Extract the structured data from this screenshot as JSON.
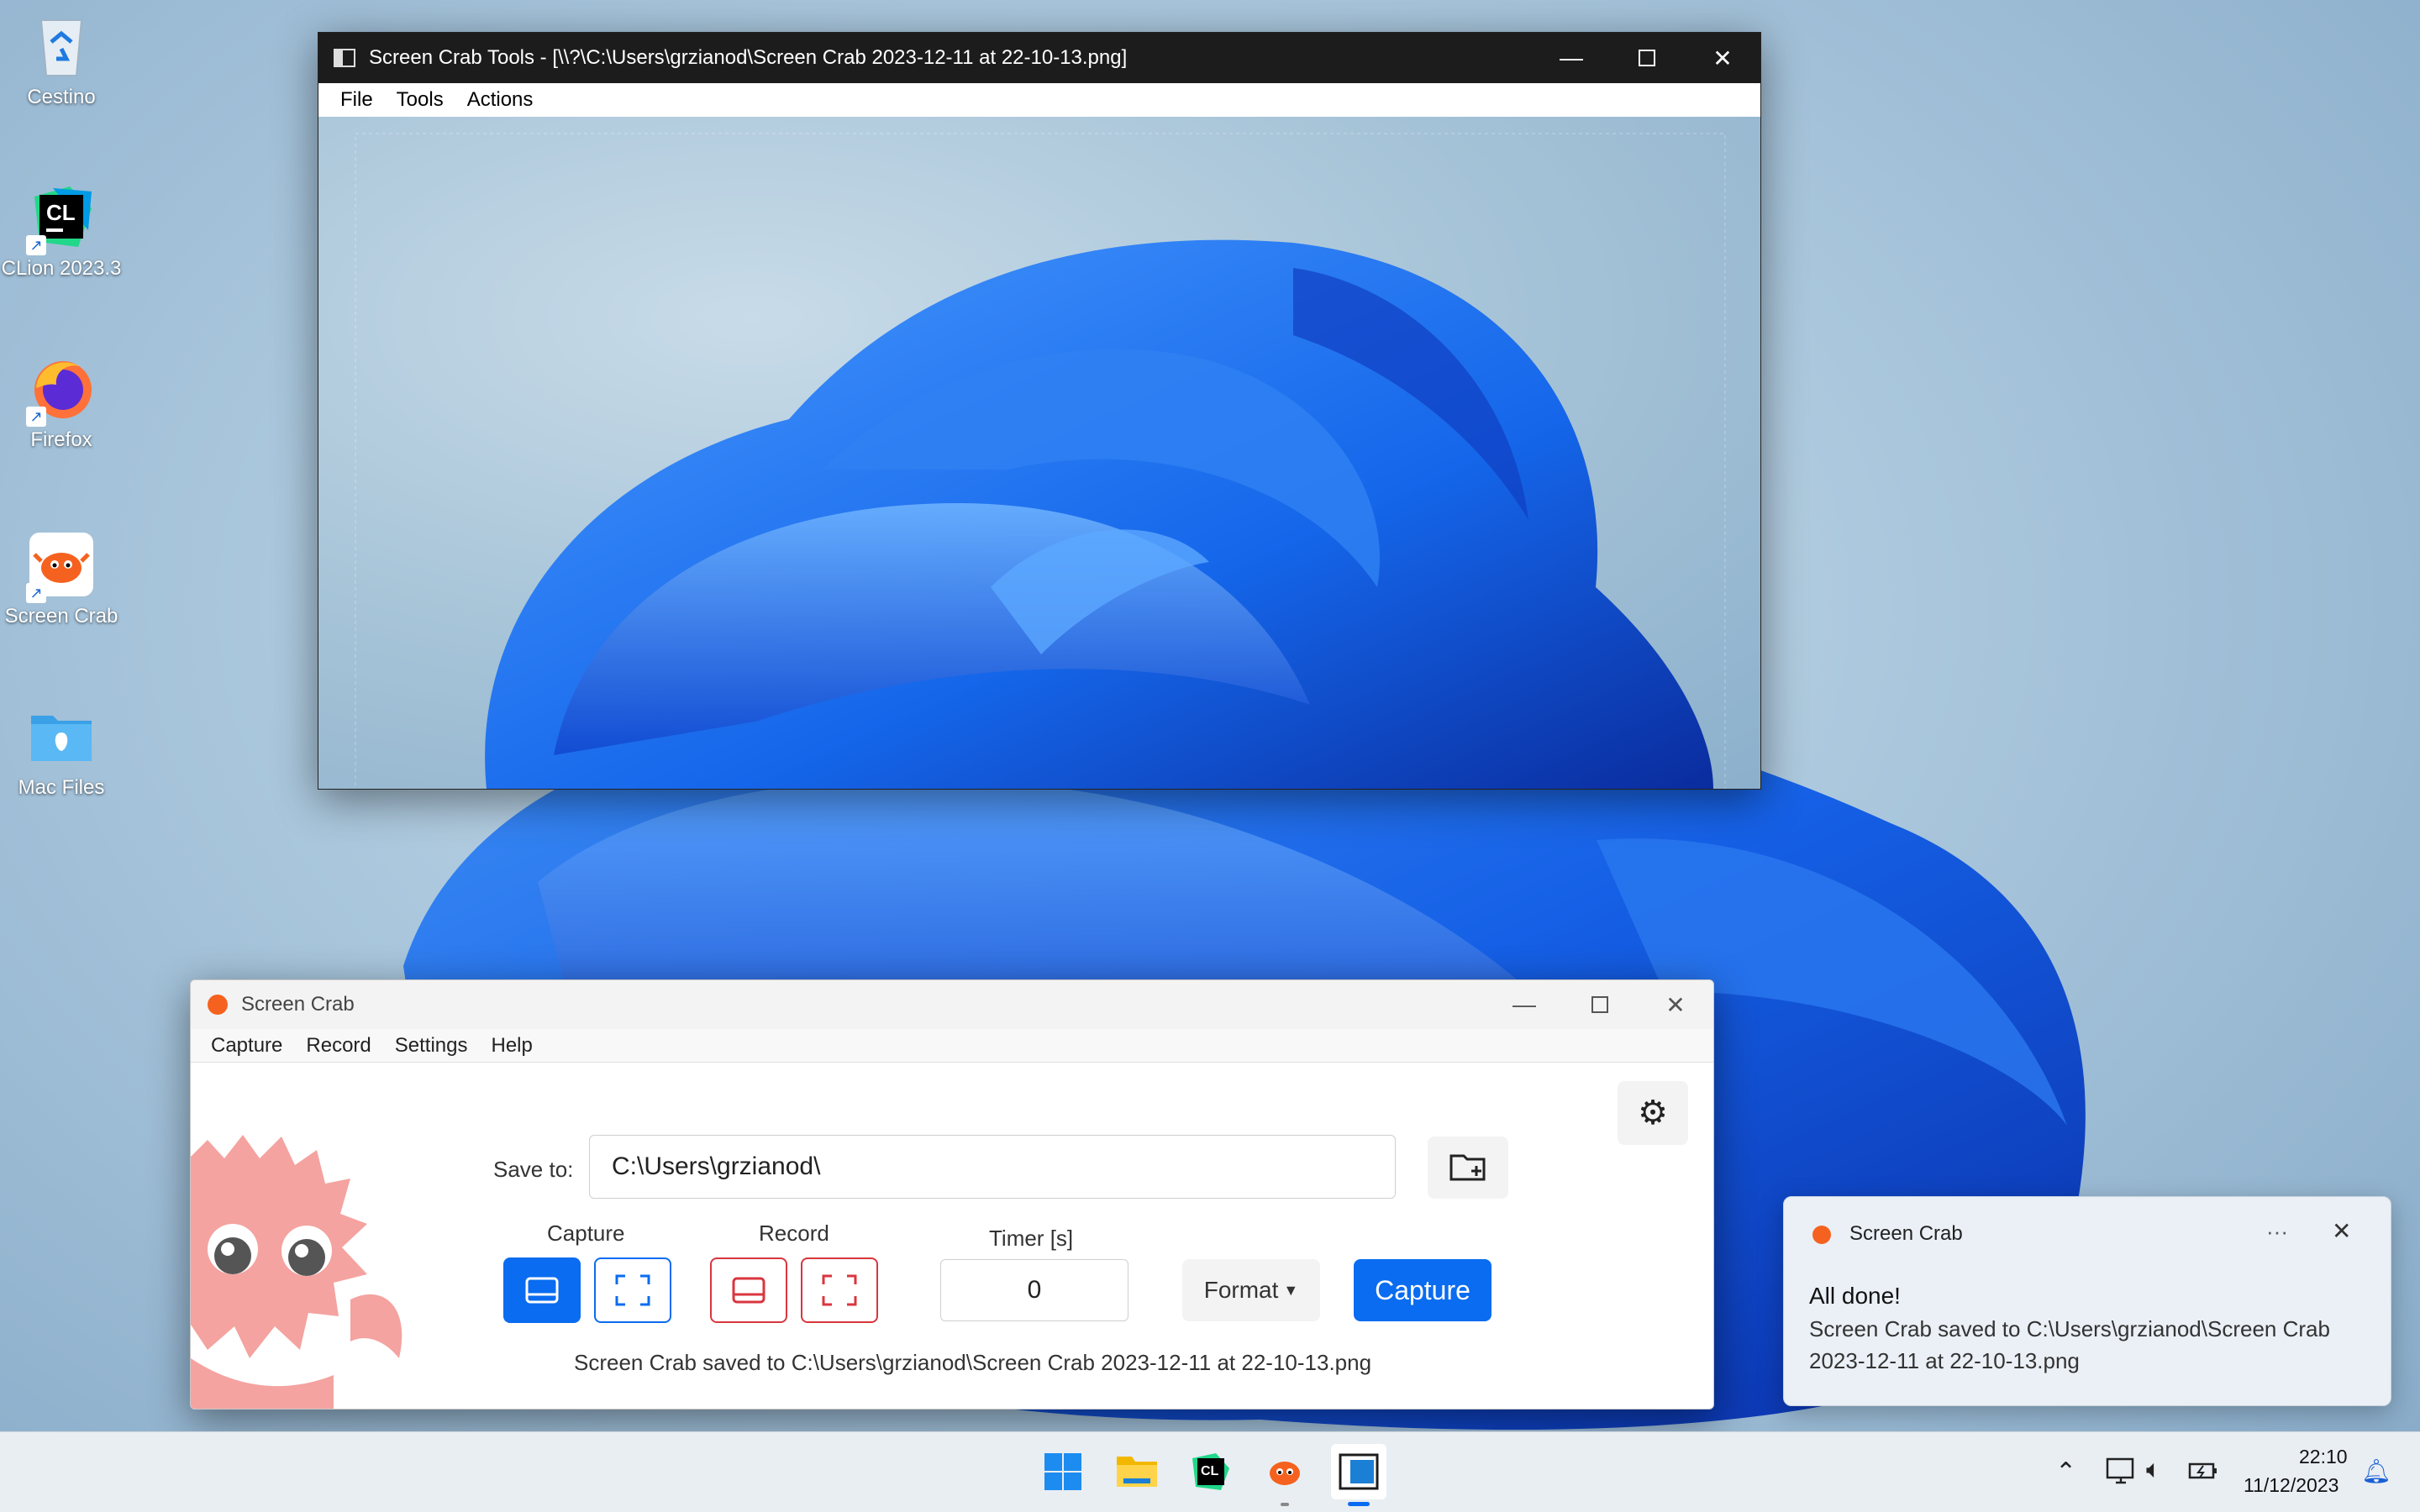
{
  "desktop": {
    "icons": [
      {
        "label": "Cestino",
        "icon": "recycle-bin-icon"
      },
      {
        "label": "CLion 2023.3",
        "icon": "clion-icon"
      },
      {
        "label": "Firefox",
        "icon": "firefox-icon"
      },
      {
        "label": "Screen Crab",
        "icon": "crab-icon"
      },
      {
        "label": "Mac Files",
        "icon": "folder-icon"
      }
    ]
  },
  "tools_window": {
    "title": "Screen Crab Tools - [\\\\?\\C:\\Users\\grzianod\\Screen Crab 2023-12-11 at 22-10-13.png]",
    "menu": [
      "File",
      "Tools",
      "Actions"
    ]
  },
  "crab_window": {
    "title": "Screen Crab",
    "menu": [
      "Capture",
      "Record",
      "Settings",
      "Help"
    ],
    "save_to_label": "Save to:",
    "save_to_value": "C:\\Users\\grzianod\\",
    "capture_group": "Capture",
    "record_group": "Record",
    "timer_label": "Timer [s]",
    "timer_value": "0",
    "format_label": "Format",
    "capture_button": "Capture",
    "status": "Screen Crab saved to C:\\Users\\grzianod\\Screen Crab 2023-12-11 at 22-10-13.png"
  },
  "notification": {
    "app": "Screen Crab",
    "more": "···",
    "heading": "All done!",
    "line1": "Screen Crab saved to C:\\Users\\grzianod\\Screen Crab",
    "line2": "2023-12-11 at 22-10-13.png"
  },
  "taskbar": {
    "time": "22:10",
    "date": "11/12/2023"
  },
  "colors": {
    "accent": "#0a6cf0",
    "record_red": "#d9363e",
    "crab_pink": "#f4a3a0"
  }
}
